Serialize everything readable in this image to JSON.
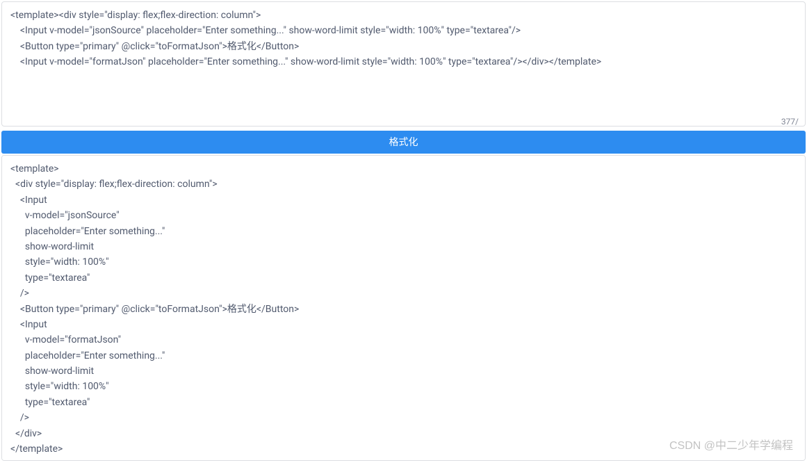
{
  "input_top": {
    "value": "<template><div style=\"display: flex;flex-direction: column\">\n    <Input v-model=\"jsonSource\" placeholder=\"Enter something...\" show-word-limit style=\"width: 100%\" type=\"textarea\"/>\n    <Button type=\"primary\" @click=\"toFormatJson\">格式化</Button>\n    <Input v-model=\"formatJson\" placeholder=\"Enter something...\" show-word-limit style=\"width: 100%\" type=\"textarea\"/></div></template>",
    "placeholder": "Enter something...",
    "char_count": "377/"
  },
  "button": {
    "label": "格式化"
  },
  "input_bottom": {
    "value": "<template>\n  <div style=\"display: flex;flex-direction: column\">\n    <Input\n      v-model=\"jsonSource\"\n      placeholder=\"Enter something...\"\n      show-word-limit\n      style=\"width: 100%\"\n      type=\"textarea\"\n    />\n    <Button type=\"primary\" @click=\"toFormatJson\">格式化</Button>\n    <Input\n      v-model=\"formatJson\"\n      placeholder=\"Enter something...\"\n      show-word-limit\n      style=\"width: 100%\"\n      type=\"textarea\"\n    />\n  </div>\n</template>",
    "placeholder": "Enter something..."
  },
  "watermark": "CSDN @中二少年学编程"
}
